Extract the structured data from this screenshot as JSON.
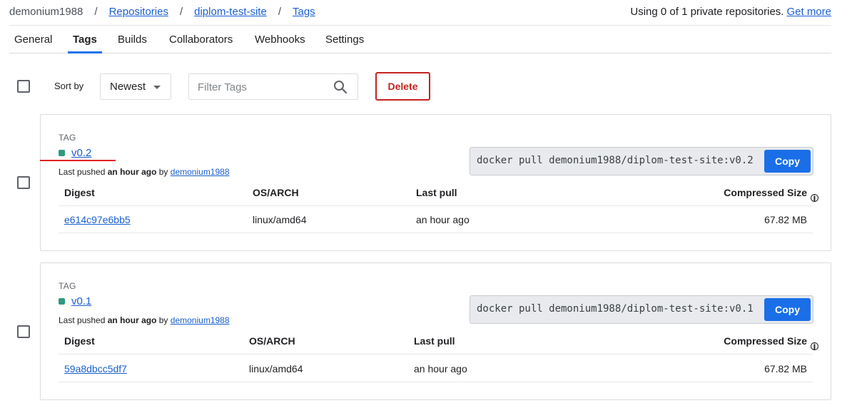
{
  "breadcrumb": {
    "user": "demonium1988",
    "repositories": "Repositories",
    "repo": "diplom-test-site",
    "current": "Tags",
    "separator": "/"
  },
  "usage": {
    "text": "Using 0 of 1 private repositories.",
    "link": "Get more"
  },
  "tabs": [
    {
      "label": "General"
    },
    {
      "label": "Tags",
      "active": true
    },
    {
      "label": "Builds"
    },
    {
      "label": "Collaborators"
    },
    {
      "label": "Webhooks"
    },
    {
      "label": "Settings"
    }
  ],
  "toolbar": {
    "sort_label": "Sort by",
    "sort_value": "Newest",
    "filter_placeholder": "Filter Tags",
    "delete_label": "Delete"
  },
  "colors": {
    "accent": "#1a73e8",
    "danger": "#c5221f",
    "tag_dot": "#2e9b80",
    "annotation": "#e02222"
  },
  "table_headers": {
    "digest": "Digest",
    "os_arch": "OS/ARCH",
    "last_pull": "Last pull",
    "compressed_size": "Compressed Size"
  },
  "tags": [
    {
      "label": "TAG",
      "name": "v0.2",
      "pushed_prefix": "Last pushed",
      "pushed_when": "an hour ago",
      "pushed_by_word": "by",
      "pushed_by": "demonium1988",
      "pull_command": "docker pull demonium1988/diplom-test-site:v0.2",
      "copy_label": "Copy",
      "digest": "e614c97e6bb5",
      "os_arch": "linux/amd64",
      "last_pull": "an hour ago",
      "size": "67.82 MB"
    },
    {
      "label": "TAG",
      "name": "v0.1",
      "pushed_prefix": "Last pushed",
      "pushed_when": "an hour ago",
      "pushed_by_word": "by",
      "pushed_by": "demonium1988",
      "pull_command": "docker pull demonium1988/diplom-test-site:v0.1",
      "copy_label": "Copy",
      "digest": "59a8dbcc5df7",
      "os_arch": "linux/amd64",
      "last_pull": "an hour ago",
      "size": "67.82 MB"
    }
  ]
}
